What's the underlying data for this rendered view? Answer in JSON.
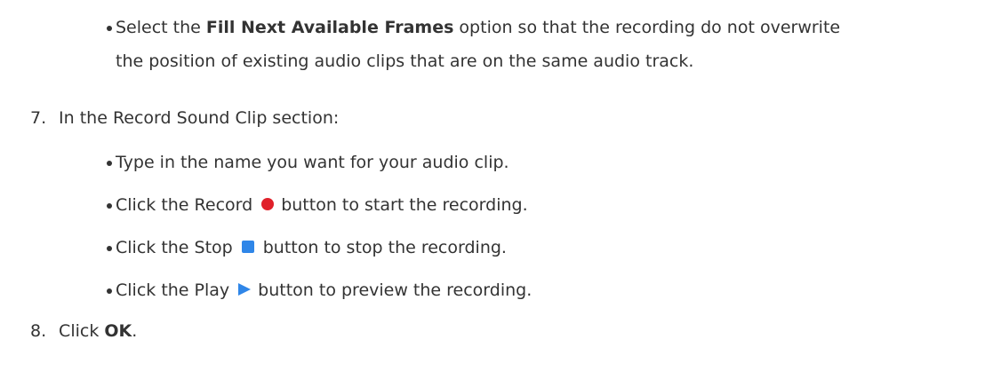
{
  "bullet_fill": {
    "pre": "Select the ",
    "bold": "Fill Next Available Frames",
    "post_line1": " option so that the recording do not overwrite",
    "line2": "the position of existing audio clips that are on the same audio track."
  },
  "step7": {
    "number": "7.",
    "text": "In the Record Sound Clip section:"
  },
  "sub_bullets": {
    "name": "Type in the name you want for your audio clip.",
    "record_pre": "Click the Record",
    "record_post": "button to start the recording.",
    "stop_pre": "Click the Stop",
    "stop_post": "button to stop the recording.",
    "play_pre": "Click the Play",
    "play_post": "button to preview the recording."
  },
  "step8": {
    "number": "8.",
    "pre": "Click ",
    "bold": "OK",
    "post": "."
  },
  "icons": {
    "record": "record-icon",
    "stop": "stop-icon",
    "play": "play-icon"
  },
  "colors": {
    "text": "#333333",
    "record": "#e0202a",
    "stop_play": "#2f86e8"
  }
}
